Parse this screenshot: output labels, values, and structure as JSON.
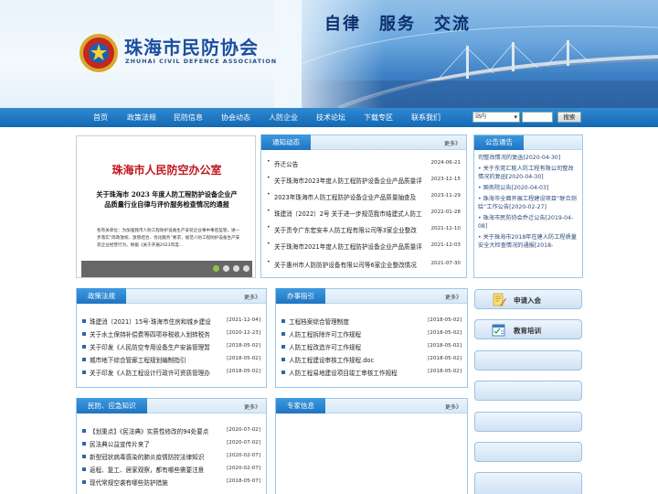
{
  "header": {
    "slogan": "自律　服务　交流",
    "title_cn": "珠海市民防协会",
    "title_en": "ZHUHAI CIVIL DEFENCE ASSOCIATION"
  },
  "nav": {
    "items": [
      "首页",
      "政策法规",
      "民防信息",
      "协会动态",
      "人防企业",
      "技术论坛",
      "下载专区",
      "联系我们"
    ],
    "site_select": "站内",
    "search_label": "搜索"
  },
  "slide": {
    "heading": "珠海市人民防空办公室",
    "subheading": "关于珠海市 2023 年度人防工程防护设备企业产品质量行业自律与评价服务检查情况的通报",
    "body": "各有关单位：为加强我市人防工程防护设备生产安装企业事中事后监管，进一步落实“简政放权、放管结合、优化服务”要求，规范人防工程防护设备生产安装企业经营行为，根据《关于开展2023年度..."
  },
  "notice": {
    "title": "通知动态",
    "more": "更多》",
    "items": [
      {
        "text": "乔迁公告",
        "date": "2024-06-21"
      },
      {
        "text": "关于珠海市2023年度人防工程防护设备企业产品质量评",
        "date": "2023-12-15"
      },
      {
        "text": "2023年珠海市人防工程防护设备企业产品质量抽查及",
        "date": "2023-11-29"
      },
      {
        "text": "珠建消〔2022〕2号 关于进一步规范我市结建式人防工",
        "date": "2022-01-28"
      },
      {
        "text": "关于责令广东宏安丰人防工程有限公司等3家企业整改",
        "date": "2021-12-10"
      },
      {
        "text": "关于珠海市2021年度人防工程防护设备企业产品质量评",
        "date": "2021-12-03"
      },
      {
        "text": "关于惠州市人防防护设备有限公司等6家企业整改情况",
        "date": "2021-07-30"
      }
    ]
  },
  "announce": {
    "title": "公告通告",
    "items": [
      "司整改情况的复函[2020-04-30]",
      "关于东莞汇能人防工程有限公司整改情况的复函[2020-04-30]",
      "国务院公告[2020-04-03]",
      "珠海市全面开展工程建设项目“联合测绘”工作公告[2020-02-27]",
      "珠海市民防协会乔迁公告[2019-04-08]",
      "关于珠海市2018年在建人防工程质量安全大检查情况的通报[2018-"
    ]
  },
  "policy": {
    "title": "政策法规",
    "more": "更多》",
    "items": [
      {
        "text": "珠建消〔2021〕15号·珠海市住房和城乡建设",
        "date": "[2021-12-04]"
      },
      {
        "text": "关于水土保持补偿费等四项非税收入划转税务",
        "date": "[2020-12-23]"
      },
      {
        "text": "关于印发《人民防空专用设备生产安装管理暂",
        "date": "[2018-05-02]"
      },
      {
        "text": "城市地下综合管廊工程规划编制指引",
        "date": "[2018-05-02]"
      },
      {
        "text": "关于印发《人防工程设计行政许可资质管理办",
        "date": "[2018-05-02]"
      }
    ]
  },
  "guide": {
    "title": "办事指引",
    "more": "更多》",
    "items": [
      {
        "text": "工程档案综合管理制度",
        "date": "[2018-05-02]"
      },
      {
        "text": "人防工程拆除许可工作规程",
        "date": "[2018-05-02]"
      },
      {
        "text": "人防工程改造许可工作规程",
        "date": "[2018-05-02]"
      },
      {
        "text": "人防工程建设审核工作规程.doc",
        "date": "[2018-05-02]"
      },
      {
        "text": "人防工程易地建设项目竣工审核工作规程",
        "date": "[2018-05-02]"
      }
    ]
  },
  "knowledge": {
    "title": "民防、应急知识",
    "more": "更多》",
    "items": [
      {
        "text": "【划重点】《民法典》实质性修改的94处要点",
        "date": "[2020-07-02]"
      },
      {
        "text": "民法典公益宣传片来了",
        "date": "[2020-07-02]"
      },
      {
        "text": "新型冠状病毒感染的肺炎疫情防控法律知识",
        "date": "[2020-02-07]"
      },
      {
        "text": "返程、复工、居家观察，都有哪些需要注意",
        "date": "[2020-02-07]"
      },
      {
        "text": "现代常规空袭有哪些防护措施",
        "date": "[2018-05-07]"
      }
    ]
  },
  "experts": {
    "title": "专家信息",
    "more": "更多》"
  },
  "side": {
    "apply_label": "申请入会",
    "training_label": "教育培训"
  }
}
